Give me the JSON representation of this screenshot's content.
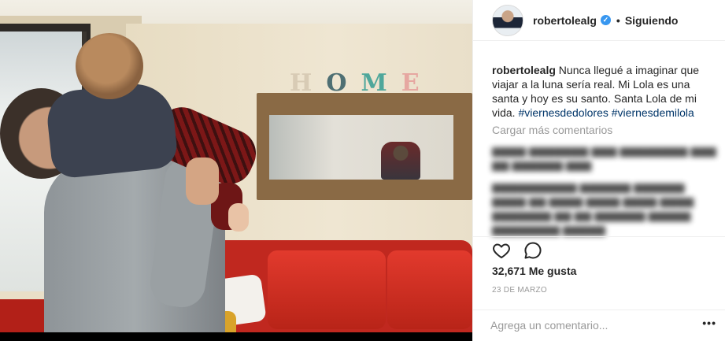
{
  "post": {
    "username": "robertolealg",
    "verified": true,
    "follow_separator": "•",
    "follow_status": "Siguiendo",
    "caption": {
      "username": "robertolealg",
      "text": "Nunca llegué a imaginar que viajar a la luna sería real. Mi Lola es una santa y hoy es su santo. Santa Lola de mi vida.",
      "hashtags": [
        "#viernesdedolores",
        "#viernesdemilola"
      ]
    },
    "load_more": "Cargar más comentarios",
    "likes": "32,671 Me gusta",
    "date": "23 DE MARZO",
    "comment_placeholder": "Agrega un comentario...",
    "more_icon": "•••"
  },
  "photo": {
    "wall_sign": [
      "H",
      "O",
      "M",
      "E"
    ],
    "wall_sign_colors": [
      "#d8cbb5",
      "#4e6f73",
      "#4fa79b",
      "#e6a7a1"
    ]
  },
  "icons": {
    "like": "heart-outline-icon",
    "comment": "speech-bubble-icon",
    "verified": "verified-badge-icon",
    "more": "more-options-icon"
  },
  "colors": {
    "verified_blue": "#3897f0",
    "hashtag_blue": "#003569",
    "muted_grey": "#999999",
    "text": "#262626"
  }
}
